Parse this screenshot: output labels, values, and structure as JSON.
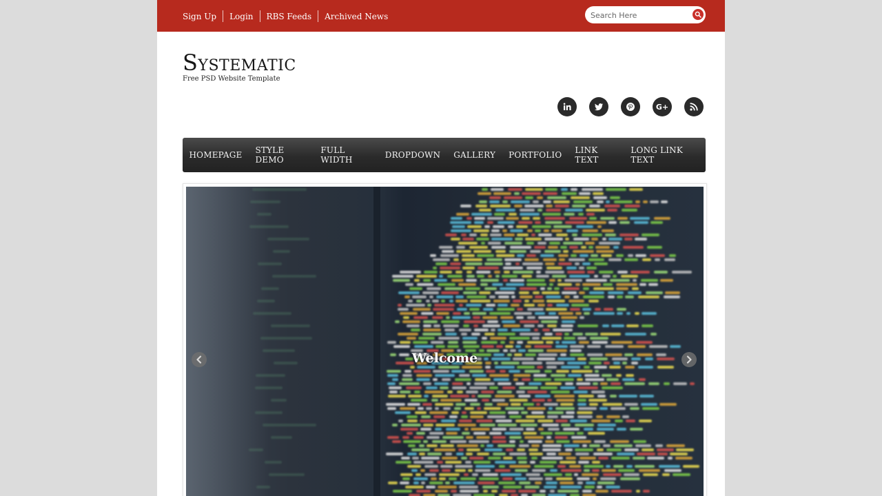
{
  "topbar": {
    "links": [
      "Sign Up",
      "Login",
      "RBS Feeds",
      "Archived News"
    ],
    "search_placeholder": "Search Here",
    "accent_color": "#b72a1e"
  },
  "brand": {
    "logo": "Systematic",
    "tagline": "Free PSD Website Template"
  },
  "social_icons": [
    "linkedin-icon",
    "twitter-icon",
    "pinterest-icon",
    "google-plus-icon",
    "rss-icon"
  ],
  "nav": {
    "items": [
      "HOMEPAGE",
      "STYLE DEMO",
      "FULL WIDTH",
      "DROPDOWN",
      "GALLERY",
      "PORTFOLIO",
      "LINK TEXT",
      "LONG LINK TEXT"
    ]
  },
  "slider": {
    "caption": "Welcome",
    "prev_icon": "chevron-left-icon",
    "next_icon": "chevron-right-icon"
  }
}
